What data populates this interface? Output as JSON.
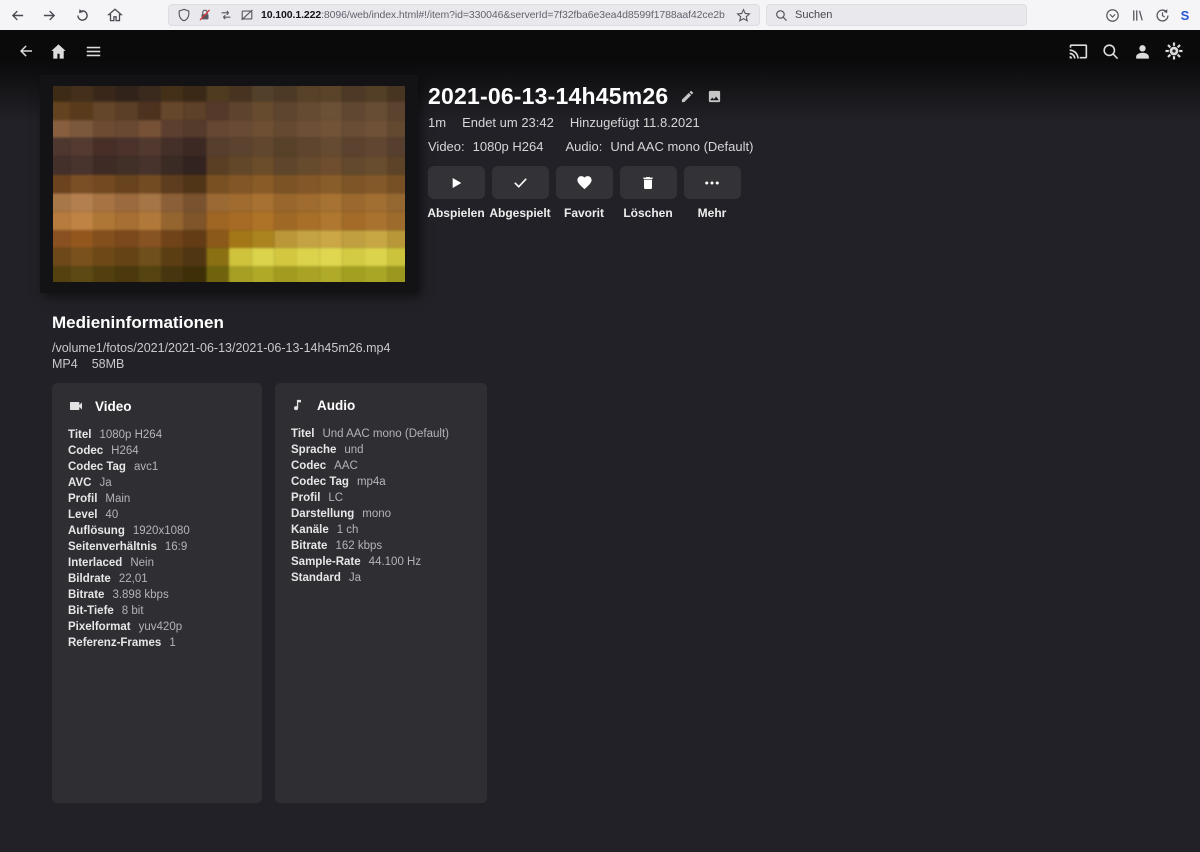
{
  "browser": {
    "url": {
      "host": "10.100.1.222",
      "rest": ":8096/web/index.html#!/item?id=330046&serverId=7f32fba6e3ea4d8599f1788aaf42ce2b"
    },
    "search_placeholder": "Suchen",
    "avatar_letter": "S",
    "icons": [
      "back",
      "forward",
      "reload",
      "home",
      "tracking-shield",
      "insecure-lock",
      "permissions",
      "images-blocked",
      "bookmark-star",
      "search",
      "pocket",
      "library",
      "history",
      "account-s"
    ]
  },
  "app_header": {
    "icons": [
      "back",
      "home",
      "menu",
      "cast",
      "search",
      "user",
      "settings"
    ]
  },
  "item": {
    "title": "2021-06-13-14h45m26",
    "title_icons": [
      "edit",
      "edit-images"
    ],
    "runtime": "1m",
    "ends_at": "Endet um 23:42",
    "added": "Hinzugefügt 11.8.2021",
    "video_label": "Video:",
    "video_value": "1080p H264",
    "audio_label": "Audio:",
    "audio_value": "Und AAC mono (Default)",
    "actions": [
      {
        "label": "Abspielen",
        "icon": "play"
      },
      {
        "label": "Abgespielt",
        "icon": "check"
      },
      {
        "label": "Favorit",
        "icon": "heart"
      },
      {
        "label": "Löschen",
        "icon": "trash"
      },
      {
        "label": "Mehr",
        "icon": "more"
      }
    ]
  },
  "media_info": {
    "heading": "Medieninformationen",
    "path": "/volume1/fotos/2021/2021-06-13/2021-06-13-14h45m26.mp4",
    "container": "MP4",
    "size": "58MB",
    "video_card": {
      "title": "Video",
      "icon": "video-camera",
      "rows": [
        [
          "Titel",
          "1080p H264"
        ],
        [
          "Codec",
          "H264"
        ],
        [
          "Codec Tag",
          "avc1"
        ],
        [
          "AVC",
          "Ja"
        ],
        [
          "Profil",
          "Main"
        ],
        [
          "Level",
          "40"
        ],
        [
          "Auflösung",
          "1920x1080"
        ],
        [
          "Seitenverhältnis",
          "16:9"
        ],
        [
          "Interlaced",
          "Nein"
        ],
        [
          "Bildrate",
          "22,01"
        ],
        [
          "Bitrate",
          "3.898 kbps"
        ],
        [
          "Bit-Tiefe",
          "8 bit"
        ],
        [
          "Pixelformat",
          "yuv420p"
        ],
        [
          "Referenz-Frames",
          "1"
        ]
      ]
    },
    "audio_card": {
      "title": "Audio",
      "icon": "music-note",
      "rows": [
        [
          "Titel",
          "Und AAC mono (Default)"
        ],
        [
          "Sprache",
          "und"
        ],
        [
          "Codec",
          "AAC"
        ],
        [
          "Codec Tag",
          "mp4a"
        ],
        [
          "Profil",
          "LC"
        ],
        [
          "Darstellung",
          "mono"
        ],
        [
          "Kanäle",
          "1 ch"
        ],
        [
          "Bitrate",
          "162 kbps"
        ],
        [
          "Sample-Rate",
          "44.100 Hz"
        ],
        [
          "Standard",
          "Ja"
        ]
      ]
    }
  },
  "colors": {
    "page_bg": "#222127",
    "card_bg": "#2f2e33",
    "browser_bg": "#f5f5f7",
    "avatar_blue": "#2456d6",
    "insecure_red": "#d7373f"
  },
  "thumbnail": {
    "rows": [
      [
        "#3d2b16",
        "#44301a",
        "#39281a",
        "#32231a",
        "#3a2a1e",
        "#443019",
        "#3b2918",
        "#4f3b20",
        "#483321",
        "#53402a",
        "#4d3a26",
        "#574128",
        "#594329",
        "#4d3926",
        "#523f26",
        "#483521"
      ],
      [
        "#63431f",
        "#593b1c",
        "#64462a",
        "#5b3f26",
        "#4d331f",
        "#65472b",
        "#5d4128",
        "#55392a",
        "#5e442e",
        "#674b2f",
        "#5d452f",
        "#654b31",
        "#6b5135",
        "#5f4731",
        "#674d33",
        "#5b432f"
      ],
      [
        "#885f3e",
        "#7b583b",
        "#6d4b33",
        "#6a4933",
        "#765136",
        "#5d3f2f",
        "#553b2b",
        "#654733",
        "#694b35",
        "#6f4f33",
        "#654931",
        "#6d4f37",
        "#735337",
        "#694d35",
        "#6f5137",
        "#644931"
      ],
      [
        "#4d372f",
        "#533b31",
        "#472f27",
        "#4b332b",
        "#51392f",
        "#452f29",
        "#3d2923",
        "#573f2d",
        "#5b432f",
        "#61472d",
        "#574129",
        "#5f452d",
        "#654b31",
        "#5b432f",
        "#614731",
        "#573f2f"
      ],
      [
        "#43302b",
        "#49332d",
        "#3e2b25",
        "#413027",
        "#47332b",
        "#3b2b25",
        "#332320",
        "#5b3f25",
        "#634729",
        "#6b4d29",
        "#5f452b",
        "#674b2d",
        "#6f4e2f",
        "#63492d",
        "#694d2f",
        "#5d4327"
      ],
      [
        "#6b431f",
        "#7b4f25",
        "#734921",
        "#69431d",
        "#734b23",
        "#5d3d1d",
        "#513517",
        "#795021",
        "#835725",
        "#895b27",
        "#7b5325",
        "#835727",
        "#895d29",
        "#7d5527",
        "#835929",
        "#775125"
      ],
      [
        "#a77747",
        "#b37f4f",
        "#a77343",
        "#9b6b3f",
        "#a57545",
        "#8b5f37",
        "#79532f",
        "#9b6933",
        "#9f6b2f",
        "#a77131",
        "#99672d",
        "#9f6b2f",
        "#a77333",
        "#9b692f",
        "#a16f31",
        "#956731"
      ],
      [
        "#b77b3d",
        "#bf8343",
        "#af7735",
        "#a76f33",
        "#b17939",
        "#95652f",
        "#7f5529",
        "#9f6523",
        "#a76b25",
        "#af7327",
        "#9f6925",
        "#a76f27",
        "#af772f",
        "#a36b27",
        "#a9732f",
        "#9d6b2b"
      ],
      [
        "#895121",
        "#93571e",
        "#834f1d",
        "#7b491b",
        "#875323",
        "#714318",
        "#633b15",
        "#8b5919",
        "#a37717",
        "#ab831f",
        "#bb9739",
        "#c3a343",
        "#cba745",
        "#bf9f3f",
        "#c7a743",
        "#b79737"
      ],
      [
        "#6d4919",
        "#79511d",
        "#6d4917",
        "#654315",
        "#6f4f1b",
        "#5b3f13",
        "#513711",
        "#8b6f13",
        "#cfc33b",
        "#dbd34b",
        "#d3c73f",
        "#dbd34b",
        "#dfd74f",
        "#d3cb43",
        "#dbd34b",
        "#cbc33b"
      ],
      [
        "#544110",
        "#5d4913",
        "#513f0f",
        "#4b390d",
        "#554311",
        "#47350f",
        "#3f2f07",
        "#6f640d",
        "#a79f23",
        "#afa927",
        "#a39b1f",
        "#a9a325",
        "#afab29",
        "#a39f21",
        "#a9a525",
        "#9b971f"
      ]
    ]
  }
}
